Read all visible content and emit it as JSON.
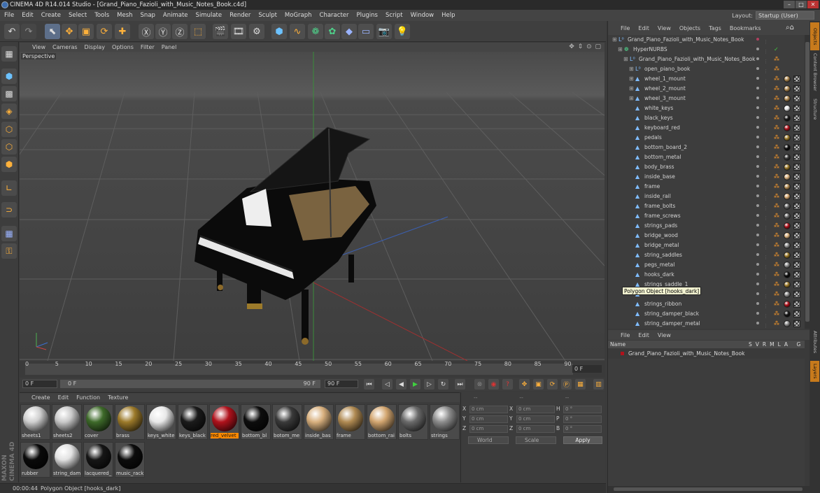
{
  "window": {
    "title": "CINEMA 4D R14.014 Studio - [Grand_Piano_Fazioli_with_Music_Notes_Book.c4d]",
    "layout_label": "Layout:",
    "layout_value": "Startup (User)"
  },
  "menubar": [
    "File",
    "Edit",
    "Create",
    "Select",
    "Tools",
    "Mesh",
    "Snap",
    "Animate",
    "Simulate",
    "Render",
    "Sculpt",
    "MoGraph",
    "Character",
    "Plugins",
    "Script",
    "Window",
    "Help"
  ],
  "viewport": {
    "menu": [
      "View",
      "Cameras",
      "Display",
      "Options",
      "Filter",
      "Panel"
    ],
    "label": "Perspective",
    "nav_icons": "✥ ⇕ ⊙ ▢"
  },
  "timeline": {
    "ticks": [
      "0",
      "5",
      "10",
      "15",
      "20",
      "25",
      "30",
      "35",
      "40",
      "45",
      "50",
      "55",
      "60",
      "65",
      "70",
      "75",
      "80",
      "85",
      "90"
    ],
    "current_frame": "0 F"
  },
  "transport": {
    "start_field": "0 F",
    "range_start": "0 F",
    "range_end": "90 F",
    "end_field": "90 F"
  },
  "material_manager": {
    "menu": [
      "Create",
      "Edit",
      "Function",
      "Texture"
    ],
    "materials": [
      {
        "label": "sheets1",
        "color": "#cfcfcf"
      },
      {
        "label": "sheets2",
        "color": "#c9c9c9"
      },
      {
        "label": "cover",
        "color": "#3e6a2a"
      },
      {
        "label": "brass",
        "color": "#9c7a2a"
      },
      {
        "label": "keys_white",
        "color": "#e8e8e8"
      },
      {
        "label": "keys_black",
        "color": "#1b1b1b"
      },
      {
        "label": "red_velvet",
        "color": "#b0121c",
        "selected": true
      },
      {
        "label": "bottom_bl",
        "color": "#0d0d0d"
      },
      {
        "label": "botom_me",
        "color": "#3a3a3a"
      },
      {
        "label": "inside_bas",
        "color": "#d8b07e"
      },
      {
        "label": "frame",
        "color": "#b08a52"
      },
      {
        "label": "bottom_rai",
        "color": "#d3a670"
      },
      {
        "label": "bolts",
        "color": "#6a6a6a"
      },
      {
        "label": "strings",
        "color": "#8c8c8c"
      },
      {
        "label": "rubber",
        "color": "#0a0a0a"
      },
      {
        "label": "string_dam",
        "color": "#e2e2e2"
      },
      {
        "label": "lacquered_",
        "color": "#161616"
      },
      {
        "label": "music_rack",
        "color": "#0c0c0c"
      }
    ]
  },
  "coordinates": {
    "header": [
      "--",
      "--",
      "--"
    ],
    "rows": [
      {
        "a": "X",
        "av": "0 cm",
        "b": "X",
        "bv": "0 cm",
        "c": "H",
        "cv": "0 °"
      },
      {
        "a": "Y",
        "av": "0 cm",
        "b": "Y",
        "bv": "0 cm",
        "c": "P",
        "cv": "0 °"
      },
      {
        "a": "Z",
        "av": "0 cm",
        "b": "Z",
        "bv": "0 cm",
        "c": "B",
        "cv": "0 °"
      }
    ],
    "mode1": "World",
    "mode2": "Scale",
    "apply": "Apply"
  },
  "status": {
    "time": "00:00:44",
    "message": "Polygon Object [hooks_dark]"
  },
  "object_manager": {
    "menu": [
      "File",
      "Edit",
      "View",
      "Objects",
      "Tags",
      "Bookmarks"
    ],
    "objects": [
      {
        "name": "Grand_Piano_Fazioli_with_Music_Notes_Book",
        "depth": 0,
        "icon": "null",
        "mat": ""
      },
      {
        "name": "HyperNURBS",
        "depth": 1,
        "icon": "nurbs",
        "mat": ""
      },
      {
        "name": "Grand_Piano_Fazioli_with_Music_Notes_Book",
        "depth": 2,
        "icon": "null",
        "mat": ""
      },
      {
        "name": "open_piano_book",
        "depth": 3,
        "icon": "null",
        "mat": ""
      },
      {
        "name": "wheel_1_mount",
        "depth": 3,
        "icon": "poly",
        "mat": "#b08a52"
      },
      {
        "name": "wheel_2_mount",
        "depth": 3,
        "icon": "poly",
        "mat": "#b08a52"
      },
      {
        "name": "wheel_3_mount",
        "depth": 3,
        "icon": "poly",
        "mat": "#b08a52"
      },
      {
        "name": "white_keys",
        "depth": 3,
        "icon": "poly",
        "mat": "#e8e8e8"
      },
      {
        "name": "black_keys",
        "depth": 3,
        "icon": "poly",
        "mat": "#1b1b1b"
      },
      {
        "name": "keyboard_red",
        "depth": 3,
        "icon": "poly",
        "mat": "#b0121c"
      },
      {
        "name": "pedals",
        "depth": 3,
        "icon": "poly",
        "mat": "#9c7a2a"
      },
      {
        "name": "bottom_board_2",
        "depth": 3,
        "icon": "poly",
        "mat": "#0d0d0d"
      },
      {
        "name": "bottom_metal",
        "depth": 3,
        "icon": "poly",
        "mat": "#3a3a3a"
      },
      {
        "name": "body_brass",
        "depth": 3,
        "icon": "poly",
        "mat": "#9c7a2a"
      },
      {
        "name": "inside_base",
        "depth": 3,
        "icon": "poly",
        "mat": "#d8b07e"
      },
      {
        "name": "frame",
        "depth": 3,
        "icon": "poly",
        "mat": "#b08a52"
      },
      {
        "name": "inside_rail",
        "depth": 3,
        "icon": "poly",
        "mat": "#d3a670"
      },
      {
        "name": "frame_bolts",
        "depth": 3,
        "icon": "poly",
        "mat": "#6a6a6a"
      },
      {
        "name": "frame_screws",
        "depth": 3,
        "icon": "poly",
        "mat": "#6a6a6a"
      },
      {
        "name": "strings_pads",
        "depth": 3,
        "icon": "poly",
        "mat": "#b0121c"
      },
      {
        "name": "bridge_wood",
        "depth": 3,
        "icon": "poly",
        "mat": "#d8b07e"
      },
      {
        "name": "bridge_metal",
        "depth": 3,
        "icon": "poly",
        "mat": "#8c8c8c"
      },
      {
        "name": "string_saddles",
        "depth": 3,
        "icon": "poly",
        "mat": "#9c7a2a"
      },
      {
        "name": "pegs_metal",
        "depth": 3,
        "icon": "poly",
        "mat": "#8c8c8c"
      },
      {
        "name": "hooks_dark",
        "depth": 3,
        "icon": "poly",
        "mat": "#0d0d0d"
      },
      {
        "name": "strings_saddle_1",
        "depth": 3,
        "icon": "poly",
        "mat": "#9c7a2a"
      },
      {
        "name": "",
        "depth": 3,
        "icon": "poly",
        "mat": "#8c8c8c"
      },
      {
        "name": "strings_ribbon",
        "depth": 3,
        "icon": "poly",
        "mat": "#b0121c"
      },
      {
        "name": "string_damper_black",
        "depth": 3,
        "icon": "poly",
        "mat": "#161616"
      },
      {
        "name": "string_damper_metal",
        "depth": 3,
        "icon": "poly",
        "mat": "#8c8c8c"
      }
    ],
    "tooltip": "Polygon Object [hooks_dark]"
  },
  "layer_manager": {
    "menu": [
      "File",
      "Edit",
      "View"
    ],
    "header_name": "Name",
    "header_cols": "SVRMLA G",
    "row_name": "Grand_Piano_Fazioli_with_Music_Notes_Book"
  },
  "side_tabs": [
    "Objects",
    "Content Browser",
    "Structure",
    "Attributes",
    "Layers"
  ]
}
